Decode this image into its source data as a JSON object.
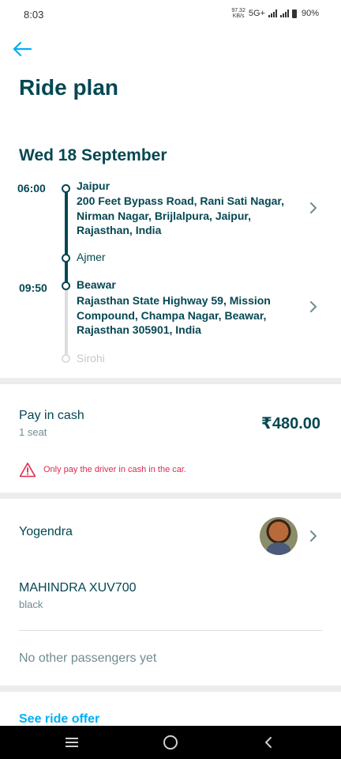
{
  "status_bar": {
    "time": "8:03",
    "net_speed_value": "97.32",
    "net_speed_unit": "KB/s",
    "network_type": "5G+",
    "battery": "90%"
  },
  "header": {
    "title": "Ride plan"
  },
  "trip": {
    "date": "Wed 18 September",
    "departure": {
      "time": "06:00",
      "city": "Jaipur",
      "address": "200 Feet Bypass Road, Rani Sati Nagar, Nirman Nagar, Brijlalpura, Jaipur, Rajasthan, India"
    },
    "stopover": "Ajmer",
    "arrival": {
      "time": "09:50",
      "city": "Beawar",
      "address": "Rajasthan State Highway 59, Mission Compound, Champa Nagar, Beawar, Rajasthan 305901, India"
    },
    "final_destination": "Sirohi"
  },
  "payment": {
    "label": "Pay in cash",
    "seats": "1 seat",
    "price": "₹480.00",
    "warning": "Only pay the driver in cash in the car."
  },
  "driver": {
    "name": "Yogendra"
  },
  "vehicle": {
    "model": "MAHINDRA XUV700",
    "color": "black"
  },
  "passengers": {
    "text": "No other passengers yet"
  },
  "links": {
    "see_ride_offer": "See ride offer"
  },
  "colors": {
    "primary": "#054752",
    "accent": "#00aff5",
    "warning": "#e0294d",
    "muted": "#708c91"
  }
}
